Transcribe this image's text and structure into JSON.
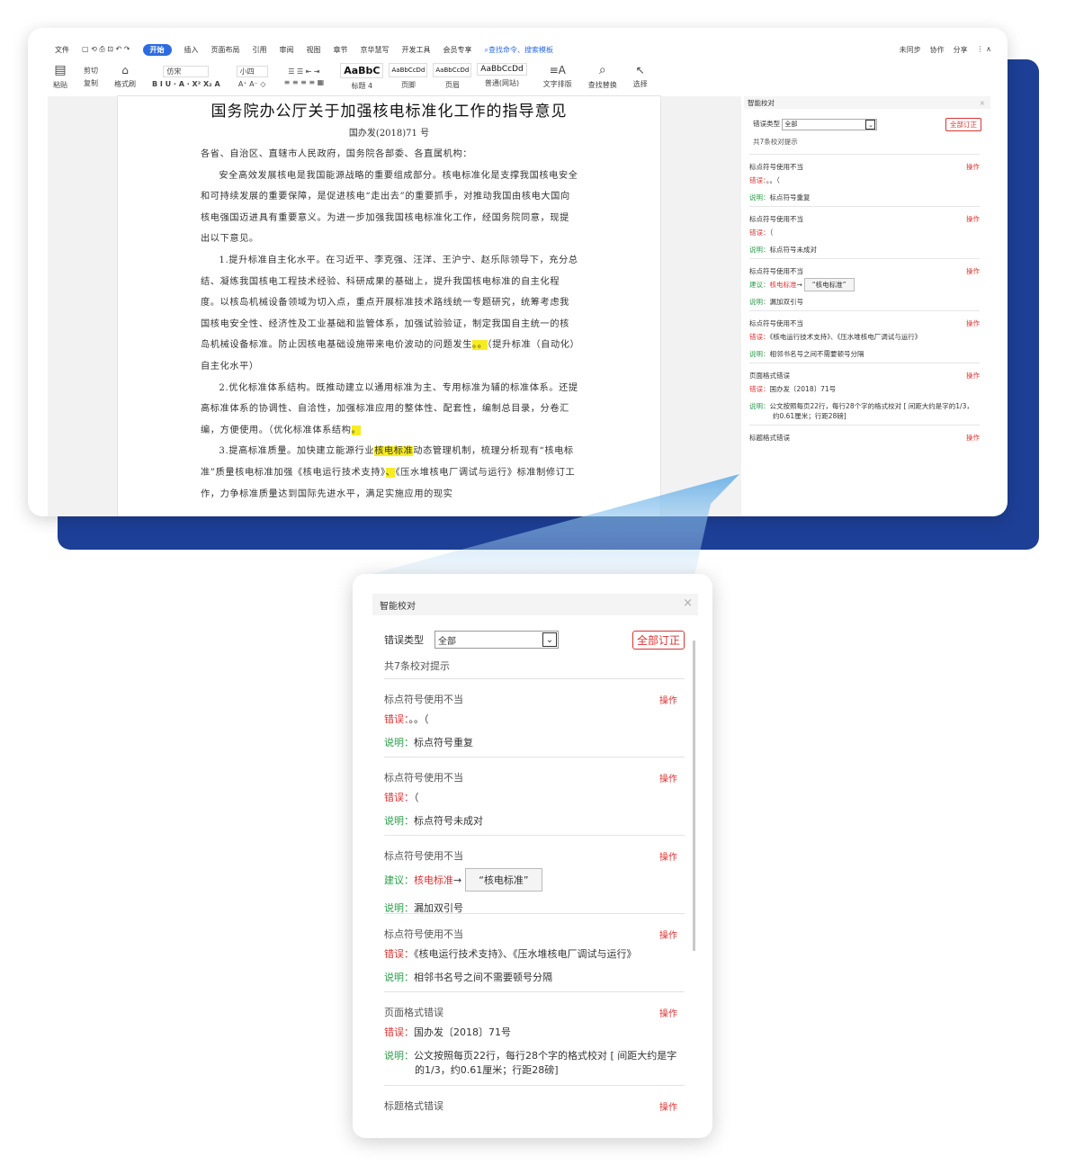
{
  "menu": {
    "items": [
      "文件",
      "开始",
      "插入",
      "页面布局",
      "引用",
      "审阅",
      "视图",
      "章节",
      "京华慧写",
      "开发工具",
      "会员专享"
    ],
    "search": "查找命令、搜索模板",
    "right": [
      "未同步",
      "协作",
      "分享"
    ]
  },
  "ribbon": {
    "paste": "粘贴",
    "cut": "剪切",
    "copy": "复制",
    "format_painter": "格式刷",
    "font": "仿宋",
    "size": "小四",
    "styles": [
      "AaBbC",
      "AaBbCcDd",
      "AaBbCcDd",
      "AaBbCcDd"
    ],
    "style_names": [
      "标题 4",
      "页脚",
      "页眉",
      "普通(网站)"
    ],
    "text_layout": "文字排版",
    "find_replace": "查找替换",
    "select": "选择"
  },
  "document": {
    "title": "国务院办公厅关于加强核电标准化工作的指导意见",
    "number": "国办发(2018)71 号",
    "salutation": "各省、自治区、直辖市人民政府，国务院各部委、各直属机构：",
    "p1": "安全高效发展核电是我国能源战略的重要组成部分。核电标准化是支撑我国核电安全和可持续发展的重要保障，是促进核电“走出去”的重要抓手，对推动我国由核电大国向核电强国迈进具有重要意义。为进一步加强我国核电标准化工作，经国务院同意，现提出以下意见。",
    "p2_before": "1.提升标准自主化水平。在习近平、李克强、汪洋、王沪宁、赵乐际领导下，充分总结、凝练我国核电工程技术经验、科研成果的基础上，提升我国核电标准的自主化程度。以核岛机械设备领域为切入点，重点开展标准技术路线统一专题研究，统筹考虑我国核电安全性、经济性及工业基础和监管体系，加强试验验证，制定我国自主统一的核岛机械设备标准。防止因核电基础设施带来电价波动的问题发生",
    "p2_hl": "。。",
    "p2_after": "（提升标准（自动化）自主化水平）",
    "p3_before": "2.优化标准体系结构。既推动建立以通用标准为主、专用标准为辅的标准体系。还提高标准体系的协调性、自洽性，加强标准应用的整体性、配套性，编制总目录，分卷汇编，方便使用。（优化标准体系结构",
    "p3_hl": "。",
    "p4_a": "3.提高标准质量。加快建立能源行业",
    "p4_hl1": "核电标准",
    "p4_b": "动态管理机制，梳理分析现有“核电标准”质量核电标准加强《核电运行技术支持》",
    "p4_hl2": "、",
    "p4_c": "《压水堆核电厂调试与运行》标准制修订工作，力争标准质量达到国际先进水平，满足实施应用的现实"
  },
  "panel": {
    "title": "智能校对",
    "error_type_label": "错误类型",
    "error_type_value": "全部",
    "fix_all": "全部订正",
    "count": "共7条校对提示",
    "items": [
      {
        "title": "标点符号使用不当",
        "op": "操作",
        "k1": "错误：",
        "v1": "。。（",
        "k2": "说明：",
        "v2": "标点符号重复"
      },
      {
        "title": "标点符号使用不当",
        "op": "操作",
        "k1": "错误：",
        "v1": "（",
        "k2": "说明：",
        "v2": "标点符号未成对"
      },
      {
        "title": "标点符号使用不当",
        "op": "操作",
        "k1": "建议：",
        "v1": "核电标准",
        "arrow": "→",
        "sugg": "“核电标准”",
        "k2": "说明：",
        "v2": "漏加双引号"
      },
      {
        "title": "标点符号使用不当",
        "op": "操作",
        "k1": "错误：",
        "v1": "《核电运行技术支持》、《压水堆核电厂调试与运行》",
        "k2": "说明：",
        "v2": "相邻书名号之间不需要顿号分隔"
      },
      {
        "title": "页面格式错误",
        "op": "操作",
        "k1": "错误：",
        "v1": "国办发〔2018〕71号",
        "k2": "说明：",
        "v2": "公文按照每页22行，每行28个字的格式校对 [ 间距大约是字的1/3，约0.61厘米；行距28磅]"
      },
      {
        "title": "标题格式错误",
        "op": "操作"
      }
    ]
  },
  "colors": {
    "brand_blue": "#1d3f96",
    "error_red": "#d33",
    "ok_green": "#2a9d4a",
    "highlight": "#f7ec22"
  }
}
